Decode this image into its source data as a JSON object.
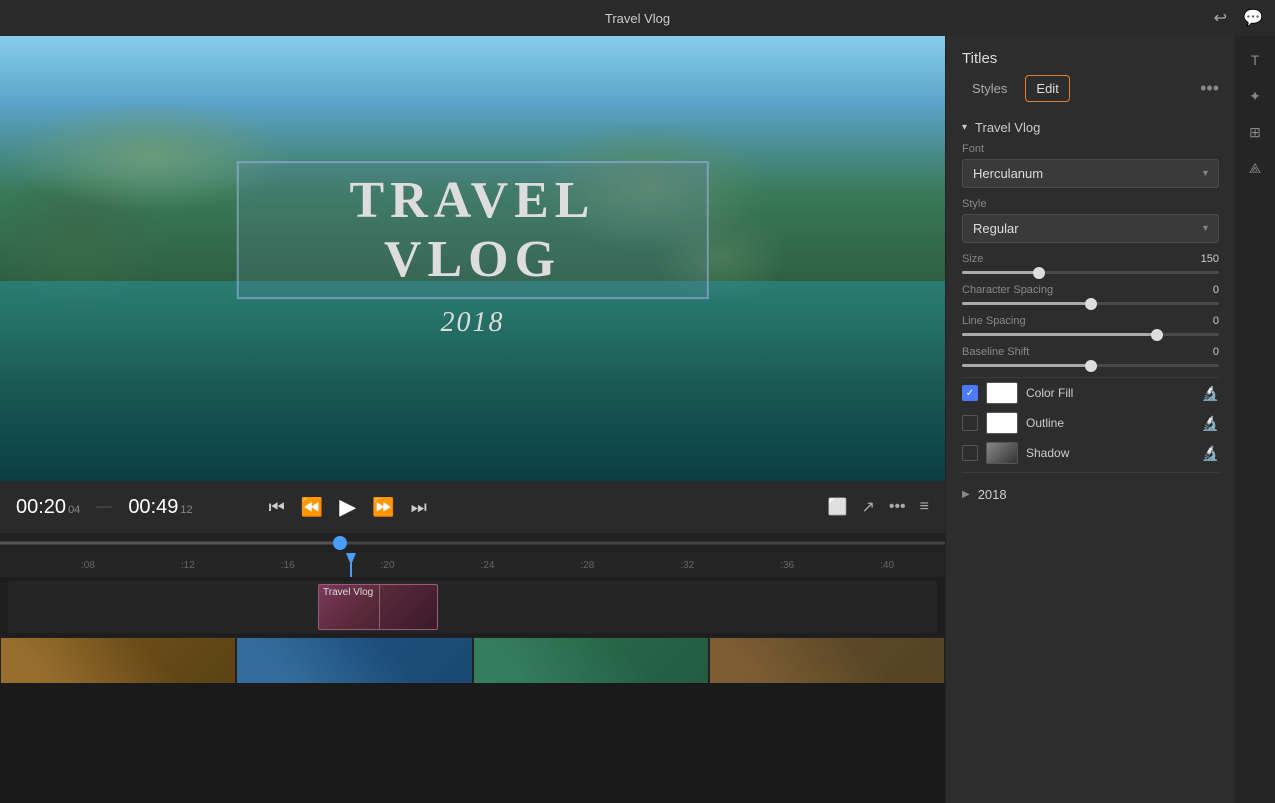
{
  "app": {
    "title": "Travel Vlog"
  },
  "topbar": {
    "title": "Travel Vlog",
    "undo_icon": "↩",
    "chat_icon": "💬"
  },
  "preview": {
    "main_title": "TRAVEL VLOG",
    "subtitle": "2018"
  },
  "playback": {
    "current_time": "00:20",
    "current_frames": "04",
    "total_time": "00:49",
    "total_frames": "12",
    "skip_back_icon": "⏮",
    "step_back_icon": "⏪",
    "play_icon": "▶",
    "step_fwd_icon": "⏩",
    "skip_fwd_icon": "⏭"
  },
  "timeline": {
    "marks": [
      ":08",
      ":12",
      ":16",
      ":20",
      ":24",
      ":28",
      ":32",
      ":36",
      ":40"
    ],
    "clip_label": "Travel Vlog"
  },
  "panel": {
    "title": "Titles",
    "tab_styles": "Styles",
    "tab_edit": "Edit",
    "more_icon": "•••",
    "section_travel_vlog": "Travel Vlog",
    "font_label": "Font",
    "font_value": "Herculanum",
    "style_label": "Style",
    "style_value": "Regular",
    "size_label": "Size",
    "size_value": "150",
    "char_spacing_label": "Character Spacing",
    "char_spacing_value": "0",
    "char_spacing_pct": 50,
    "line_spacing_label": "Line Spacing",
    "line_spacing_value": "0",
    "line_spacing_pct": 76,
    "baseline_shift_label": "Baseline Shift",
    "baseline_shift_value": "0",
    "baseline_shift_pct": 50,
    "color_fill_label": "Color Fill",
    "outline_label": "Outline",
    "shadow_label": "Shadow",
    "section_2018": "2018"
  }
}
